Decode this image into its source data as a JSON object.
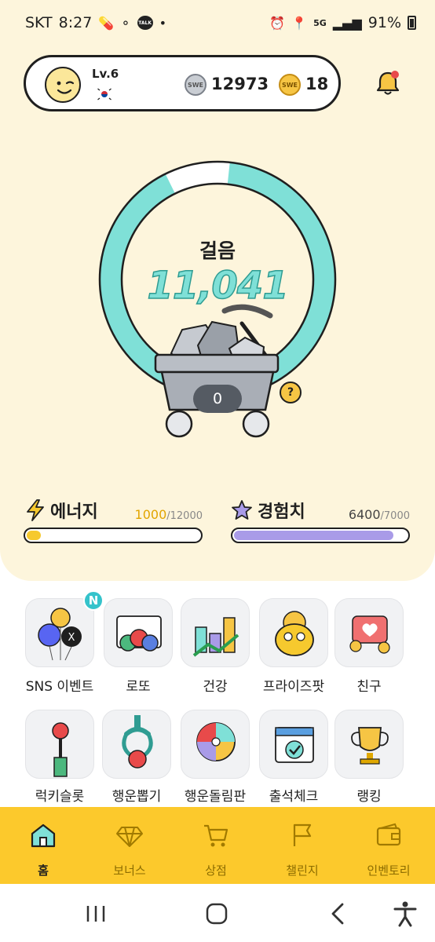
{
  "status_bar": {
    "carrier": "SKT",
    "time": "8:27",
    "talk_badge": "TALK",
    "network": "5G",
    "battery": "91%",
    "icons": [
      "pill-icon",
      "toggle-icon",
      "talk-icon",
      "dot-icon",
      "alarm-icon",
      "location-icon",
      "5g-icon",
      "signal-icon",
      "battery-icon"
    ]
  },
  "profile": {
    "level": "Lv.6",
    "flag_icon": "korea-flag-icon",
    "silver_coins": "12973",
    "gold_coins": "18",
    "coin_glyph": "SWE"
  },
  "notifications": {
    "icon": "bell-icon",
    "has_unread": true
  },
  "walk": {
    "label": "걸음",
    "steps": "11,041",
    "progress": 0.91,
    "mine_count": "0",
    "help": "?"
  },
  "energy": {
    "label": "에너지",
    "current": "1000",
    "max": "/12000",
    "fraction": 0.083
  },
  "experience": {
    "label": "경험치",
    "current": "6400",
    "max": "/7000",
    "fraction": 0.914
  },
  "menu": [
    {
      "label": "SNS 이벤트",
      "icon": "balloons-icon",
      "badge": "N"
    },
    {
      "label": "로또",
      "icon": "lotto-icon"
    },
    {
      "label": "건강",
      "icon": "health-chart-icon"
    },
    {
      "label": "프라이즈팟",
      "icon": "prize-pot-icon"
    },
    {
      "label": "친구",
      "icon": "friends-icon"
    },
    {
      "label": "럭키슬롯",
      "icon": "lucky-slot-icon"
    },
    {
      "label": "행운뽑기",
      "icon": "claw-machine-icon"
    },
    {
      "label": "행운돌림판",
      "icon": "roulette-icon"
    },
    {
      "label": "출석체크",
      "icon": "calendar-check-icon"
    },
    {
      "label": "랭킹",
      "icon": "trophy-icon"
    }
  ],
  "bottom_nav": [
    {
      "label": "홈",
      "icon": "home-icon",
      "active": true
    },
    {
      "label": "보너스",
      "icon": "diamond-icon",
      "active": false
    },
    {
      "label": "상점",
      "icon": "cart-icon",
      "active": false
    },
    {
      "label": "챌린지",
      "icon": "flag-icon",
      "active": false
    },
    {
      "label": "인벤토리",
      "icon": "wallet-icon",
      "active": false
    }
  ],
  "colors": {
    "background": "#fdf5dc",
    "accent_yellow": "#fcc92c",
    "ring_teal": "#7fe0d7",
    "energy_fill": "#f6c92e",
    "exp_fill": "#a99be8",
    "badge_teal": "#35c3cb"
  }
}
